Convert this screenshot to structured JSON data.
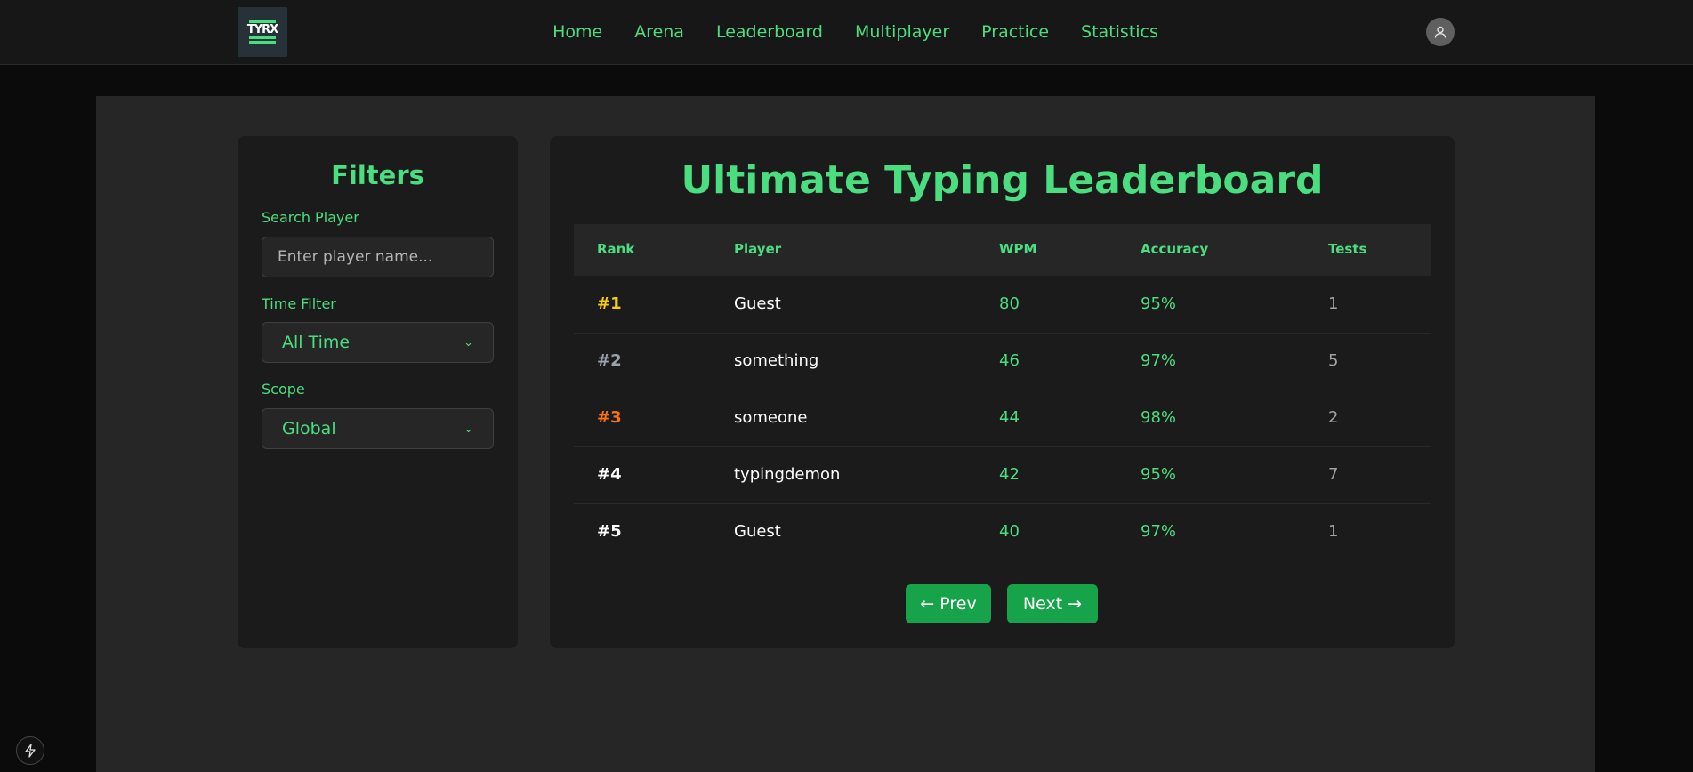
{
  "brand": {
    "logo_text": "TYRX"
  },
  "nav": {
    "links": [
      "Home",
      "Arena",
      "Leaderboard",
      "Multiplayer",
      "Practice",
      "Statistics"
    ]
  },
  "filters": {
    "title": "Filters",
    "search_label": "Search Player",
    "search_placeholder": "Enter player name...",
    "search_value": "",
    "time_label": "Time Filter",
    "time_value": "All Time",
    "scope_label": "Scope",
    "scope_value": "Global"
  },
  "leaderboard": {
    "title": "Ultimate Typing Leaderboard",
    "columns": [
      "Rank",
      "Player",
      "WPM",
      "Accuracy",
      "Tests"
    ],
    "rows": [
      {
        "rank": "#1",
        "player": "Guest",
        "wpm": "80",
        "accuracy": "95%",
        "tests": "1"
      },
      {
        "rank": "#2",
        "player": "something",
        "wpm": "46",
        "accuracy": "97%",
        "tests": "5"
      },
      {
        "rank": "#3",
        "player": "someone",
        "wpm": "44",
        "accuracy": "98%",
        "tests": "2"
      },
      {
        "rank": "#4",
        "player": "typingdemon",
        "wpm": "42",
        "accuracy": "95%",
        "tests": "7"
      },
      {
        "rank": "#5",
        "player": "Guest",
        "wpm": "40",
        "accuracy": "97%",
        "tests": "1"
      }
    ],
    "prev_label": "← Prev",
    "next_label": "Next →"
  },
  "colors": {
    "accent": "#4ade80",
    "button": "#16a34a",
    "rank_gold": "#facc15",
    "rank_silver": "#9ca3af",
    "rank_bronze": "#f97316",
    "rank_default": "#ffffff"
  },
  "icons": {
    "avatar": "user-icon",
    "corner": "bolt-icon"
  }
}
